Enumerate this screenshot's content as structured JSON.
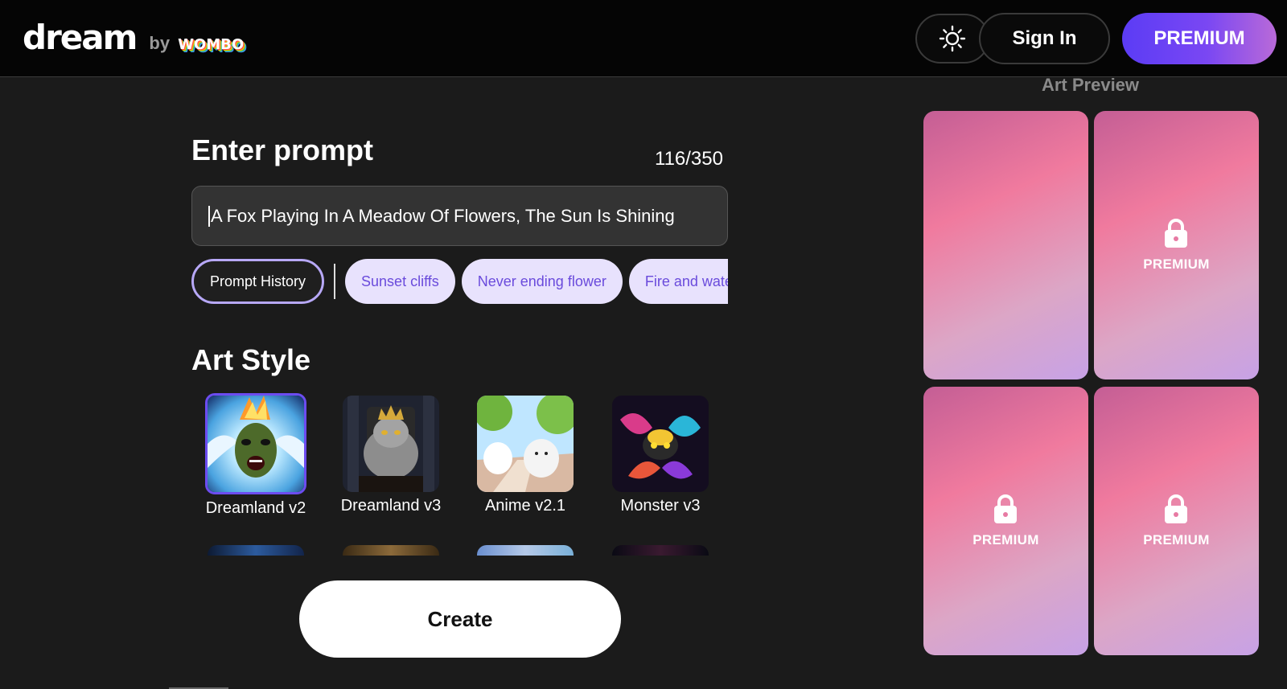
{
  "header": {
    "logo_main": "dream",
    "logo_by": "by",
    "logo_brand": "WOMBO",
    "signin_label": "Sign In",
    "premium_label": "PREMIUM"
  },
  "prompt": {
    "title": "Enter prompt",
    "char_count": "116/350",
    "value": "A Fox Playing In A Meadow Of Flowers, The Sun Is Shining"
  },
  "chips": {
    "history_label": "Prompt History",
    "suggestions": [
      "Sunset cliffs",
      "Never ending flower",
      "Fire and water"
    ]
  },
  "art_style": {
    "title": "Art Style",
    "selected": "Dreamland v2",
    "items": [
      {
        "label": "Dreamland v2"
      },
      {
        "label": "Dreamland v3"
      },
      {
        "label": "Anime v2.1"
      },
      {
        "label": "Monster v3"
      }
    ]
  },
  "create_label": "Create",
  "preview": {
    "title": "Art Preview",
    "cards": [
      {
        "label": "",
        "locked": false
      },
      {
        "label": "PREMIUM",
        "locked": true
      },
      {
        "label": "PREMIUM",
        "locked": true
      },
      {
        "label": "PREMIUM",
        "locked": true
      }
    ]
  },
  "colors": {
    "accent": "#6c4cf0",
    "premium_gradient_start": "#5b3cf5",
    "premium_gradient_end": "#b96ad8",
    "chip_bg": "#e8e2fd",
    "chip_text": "#6a4bdc"
  }
}
